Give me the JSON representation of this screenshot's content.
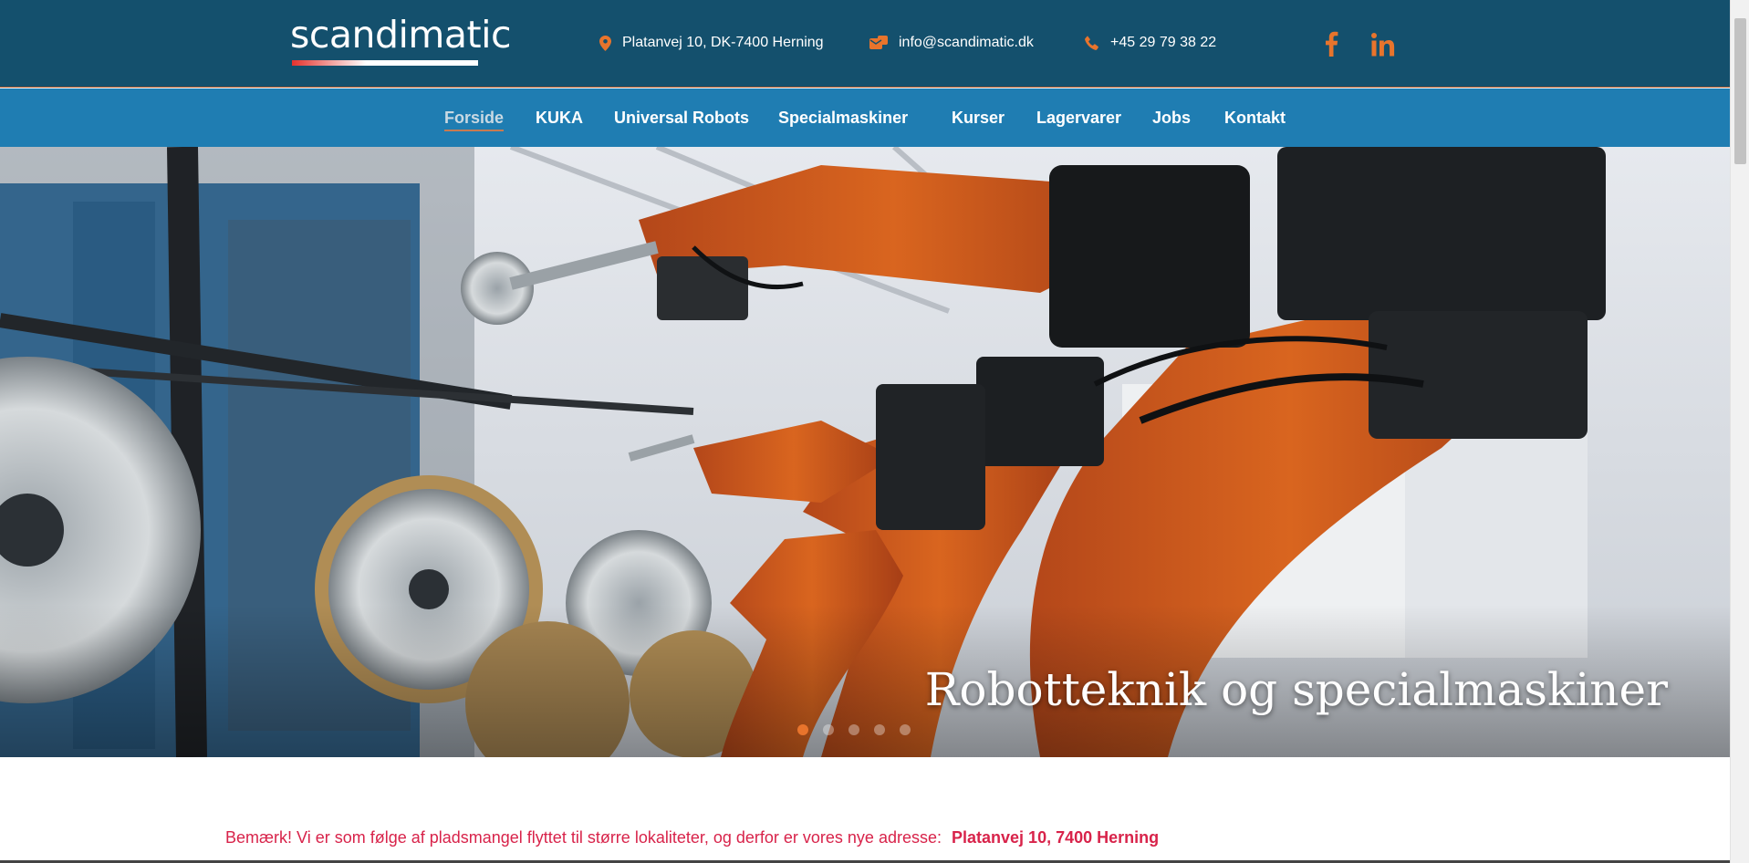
{
  "header": {
    "logo_text": "scandimatic",
    "address": "Platanvej 10, DK-7400 Herning",
    "email": "info@scandimatic.dk",
    "phone": "+45 29 79 38 22",
    "social": [
      "facebook-icon",
      "linkedin-icon"
    ]
  },
  "nav": {
    "items": [
      {
        "label": "Forside",
        "active": true
      },
      {
        "label": "KUKA"
      },
      {
        "label": "Universal Robots"
      },
      {
        "label": "Specialmaskiner"
      },
      {
        "label": "Kurser"
      },
      {
        "label": "Lagervarer"
      },
      {
        "label": "Jobs"
      },
      {
        "label": "Kontakt"
      }
    ]
  },
  "hero": {
    "caption": "Robotteknik og specialmaskiner",
    "slides": 5,
    "active_slide": 1
  },
  "notice": {
    "text": "Bemærk!  Vi er som følge af pladsmangel flyttet til større lokaliteter, og derfor er vores nye adresse:",
    "highlight": "Platanvej 10, 7400 Herning"
  },
  "colors": {
    "topbar": "#14506d",
    "navbar": "#1f7db2",
    "accent": "#e8742c",
    "notice": "#d8234a"
  }
}
